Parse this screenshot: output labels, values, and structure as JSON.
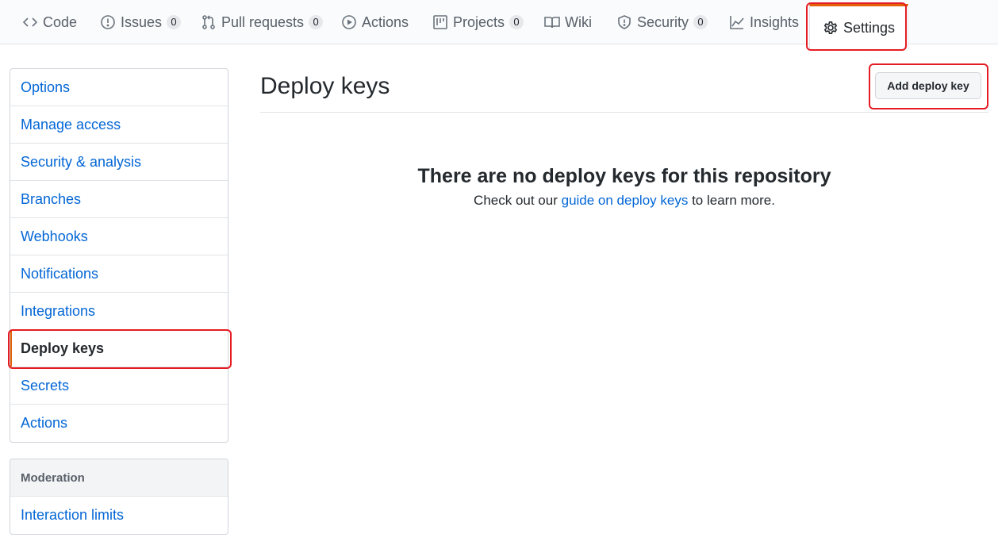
{
  "tabs": [
    {
      "label": "Code",
      "icon": "code-icon"
    },
    {
      "label": "Issues",
      "icon": "issue-opened-icon",
      "count": "0"
    },
    {
      "label": "Pull requests",
      "icon": "git-pull-request-icon",
      "count": "0"
    },
    {
      "label": "Actions",
      "icon": "play-icon"
    },
    {
      "label": "Projects",
      "icon": "project-icon",
      "count": "0"
    },
    {
      "label": "Wiki",
      "icon": "book-icon"
    },
    {
      "label": "Security",
      "icon": "shield-icon",
      "count": "0"
    },
    {
      "label": "Insights",
      "icon": "graph-icon"
    },
    {
      "label": "Settings",
      "icon": "gear-icon",
      "selected": true
    }
  ],
  "sidebar": {
    "items": [
      {
        "label": "Options"
      },
      {
        "label": "Manage access"
      },
      {
        "label": "Security & analysis"
      },
      {
        "label": "Branches"
      },
      {
        "label": "Webhooks"
      },
      {
        "label": "Notifications"
      },
      {
        "label": "Integrations"
      },
      {
        "label": "Deploy keys",
        "selected": true
      },
      {
        "label": "Secrets"
      },
      {
        "label": "Actions"
      }
    ],
    "moderation": {
      "heading": "Moderation",
      "items": [
        {
          "label": "Interaction limits"
        }
      ]
    }
  },
  "main": {
    "title": "Deploy keys",
    "add_button_label": "Add deploy key",
    "blankslate": {
      "heading": "There are no deploy keys for this repository",
      "text_before": "Check out our ",
      "link_text": "guide on deploy keys",
      "text_after": " to learn more."
    }
  },
  "colors": {
    "link": "#0366d6",
    "selected_accent": "#e36209",
    "highlight": "#e51c23"
  }
}
